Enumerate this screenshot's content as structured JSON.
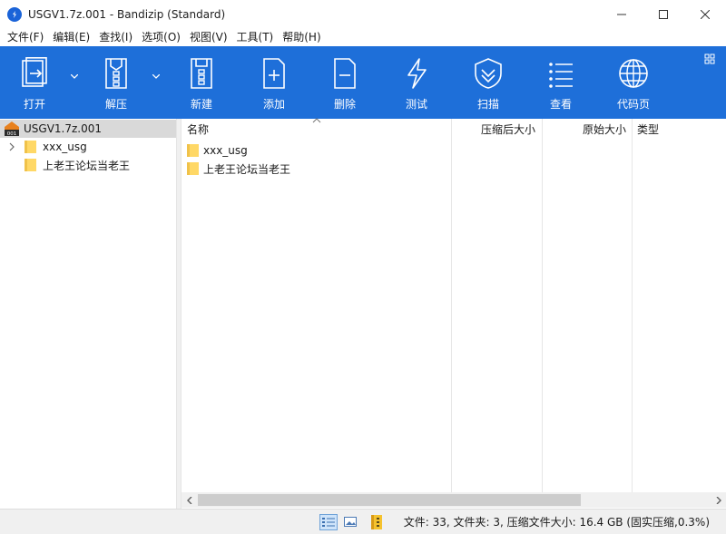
{
  "window": {
    "title": "USGV1.7z.001 - Bandizip (Standard)"
  },
  "menu": [
    "文件(F)",
    "编辑(E)",
    "查找(I)",
    "选项(O)",
    "视图(V)",
    "工具(T)",
    "帮助(H)"
  ],
  "toolbar": {
    "open": "打开",
    "extract": "解压",
    "new": "新建",
    "add": "添加",
    "delete": "删除",
    "test": "测试",
    "scan": "扫描",
    "view": "查看",
    "codepage": "代码页"
  },
  "tree": {
    "root": "USGV1.7z.001",
    "root_badge": "001",
    "children": [
      "xxx_usg",
      "上老王论坛当老王"
    ]
  },
  "list": {
    "columns": {
      "name": "名称",
      "packed": "压缩后大小",
      "original": "原始大小",
      "type": "类型"
    },
    "rows": [
      {
        "name": "xxx_usg"
      },
      {
        "name": "上老王论坛当老王"
      }
    ]
  },
  "status": {
    "text": "文件: 33, 文件夹: 3, 压缩文件大小: 16.4 GB (固实压缩,0.3%)"
  },
  "colors": {
    "toolbar_bg": "#1e6fd9",
    "folder": "#ffd866",
    "selection": "#d9d9d9"
  }
}
